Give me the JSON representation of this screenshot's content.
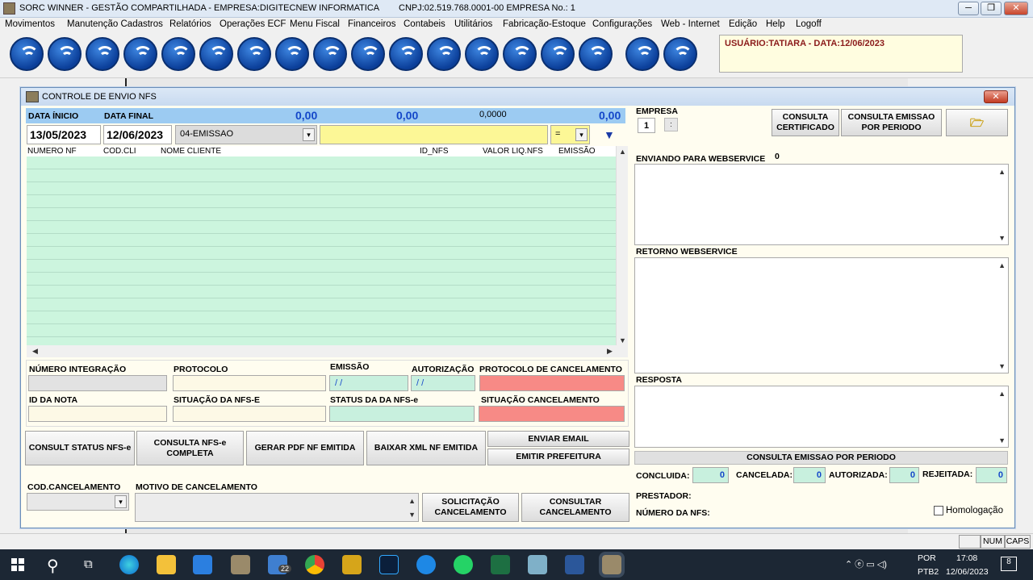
{
  "window": {
    "title": "SORC WINNER - GESTÃO COMPARTILHADA - EMPRESA:DIGITECNEW INFORMATICA",
    "cnpj": "CNPJ:02.519.768.0001-00  EMPRESA No.:     1"
  },
  "menu": [
    "Movimentos",
    "Manutenção Cadastros",
    "Relatórios",
    "Operações ECF",
    "Menu Fiscal",
    "Financeiros",
    "Contabeis",
    "Utilitários",
    "Fabricação-Estoque",
    "Configurações",
    "Web - Internet",
    "Edição",
    "Help",
    "Logoff"
  ],
  "user_info": "USUÁRIO:TATIARA - DATA:12/06/2023",
  "dialog": {
    "title": "CONTROLE DE ENVIO NFS",
    "close": "✕",
    "data_inicio_label": "DATA ÍNICIO",
    "data_final_label": "DATA FINAL",
    "total1": "0,00",
    "total2": "0,00",
    "total3": "0,0000",
    "total4": "0,00",
    "data_inicio": "13/05/2023",
    "data_final": "12/06/2023",
    "status_select": "04-EMISSAO",
    "operator": "=",
    "grid_headers": [
      "NUMERO NF",
      "COD.CLI",
      "NOME CLIENTE",
      "ID_NFS",
      "VALOR LIQ.NFS",
      "EMISSÃO"
    ],
    "numero_integracao_label": "NÚMERO INTEGRAÇÃO",
    "protocolo_label": "PROTOCOLO",
    "emissao_label": "EMISSÃO",
    "autorizacao_label": "AUTORIZAÇÃO",
    "protocolo_cancel_label": "PROTOCOLO DE CANCELAMENTO",
    "emissao_value": " / /",
    "autorizacao_value": " / /",
    "id_nota_label": "ID DA NOTA",
    "situacao_label": "SITUAÇÃO DA NFS-E",
    "status_label": "STATUS DA  DA  NFS-e",
    "situacao_cancel_label": "SITUAÇÃO CANCELAMENTO",
    "btn_consult_status": "CONSULT STATUS NFS-e",
    "btn_consulta_completa": "CONSULTA NFS-e COMPLETA",
    "btn_gerar_pdf": "GERAR PDF NF EMITIDA",
    "btn_baixar_xml": "BAIXAR XML NF EMITIDA",
    "btn_enviar_email": "ENVIAR EMAIL",
    "btn_emitir_prefeitura": "EMITIR PREFEITURA",
    "cod_cancel_label": "COD.CANCELAMENTO",
    "motivo_cancel_label": "MOTIVO DE CANCELAMENTO",
    "btn_solicitacao": "SOLICITAÇÃO CANCELAMENTO",
    "btn_consultar_cancel": "CONSULTAR CANCELAMENTO",
    "empresa_label": "EMPRESA",
    "empresa_value": "1",
    "btn_consulta_cert": "CONSULTA CERTIFICADO",
    "btn_consulta_periodo": "CONSULTA EMISSAO POR PERIODO",
    "enviando_label": "ENVIANDO PARA WEBSERVICE",
    "enviando_count": "0",
    "retorno_label": "RETORNO WEBSERVICE",
    "resposta_label": "RESPOSTA",
    "consulta_periodo_bar": "CONSULTA EMISSAO POR PERIODO",
    "concluida_label": "CONCLUIDA:",
    "concluida": "0",
    "cancelada_label": "CANCELADA:",
    "cancelada": "0",
    "autorizada_label": "AUTORIZADA:",
    "autorizada": "0",
    "rejeitada_label": "REJEITADA:",
    "rejeitada": "0",
    "prestador_label": "PRESTADOR:",
    "numero_nfs_label": "NÚMERO DA NFS:",
    "homologacao_label": "Homologação"
  },
  "status": {
    "num": "NUM",
    "caps": "CAPS"
  },
  "taskbar": {
    "badge_mail": "22",
    "lang": "POR",
    "kbd": "PTB2",
    "time": "17:08",
    "date": "12/06/2023",
    "notif": "8"
  }
}
